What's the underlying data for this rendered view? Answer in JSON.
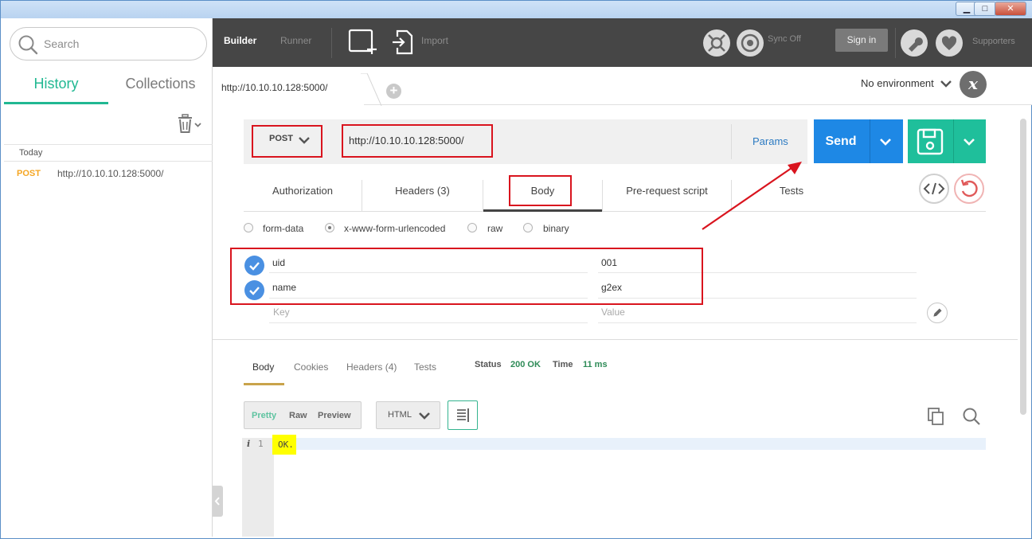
{
  "window": {
    "minimize_label": "▁",
    "maximize_label": "□",
    "close_label": "✕"
  },
  "sidebar": {
    "search_placeholder": "Search",
    "tabs": [
      {
        "label": "History",
        "active": true
      },
      {
        "label": "Collections",
        "active": false
      }
    ],
    "history_group": "Today",
    "history_items": [
      {
        "method": "POST",
        "url": "http://10.10.10.128:5000/"
      }
    ]
  },
  "toolbar": {
    "builder": "Builder",
    "runner": "Runner",
    "import": "Import",
    "sync": "Sync Off",
    "signin": "Sign in",
    "supporters": "Supporters"
  },
  "request_tabs": {
    "active_tab": "http://10.10.10.128:5000/",
    "environment": "No environment",
    "env_icon": "x"
  },
  "request": {
    "method": "POST",
    "url": "http://10.10.10.128:5000/",
    "params_label": "Params",
    "send_label": "Send"
  },
  "request_subtabs": [
    {
      "label": "Authorization"
    },
    {
      "label": "Headers (3)"
    },
    {
      "label": "Body",
      "active": true
    },
    {
      "label": "Pre-request script"
    },
    {
      "label": "Tests"
    }
  ],
  "body_types": [
    {
      "label": "form-data",
      "selected": false
    },
    {
      "label": "x-www-form-urlencoded",
      "selected": true
    },
    {
      "label": "raw",
      "selected": false
    },
    {
      "label": "binary",
      "selected": false
    }
  ],
  "body_params": [
    {
      "key": "uid",
      "value": "001",
      "enabled": true
    },
    {
      "key": "name",
      "value": "g2ex",
      "enabled": true
    }
  ],
  "new_param": {
    "key_placeholder": "Key",
    "value_placeholder": "Value"
  },
  "response": {
    "tabs": [
      {
        "label": "Body",
        "active": true
      },
      {
        "label": "Cookies"
      },
      {
        "label": "Headers (4)"
      },
      {
        "label": "Tests"
      }
    ],
    "status_label": "Status",
    "status_value": "200 OK",
    "time_label": "Time",
    "time_value": "11 ms",
    "view_modes": [
      "Pretty",
      "Raw",
      "Preview"
    ],
    "active_view": "Pretty",
    "format": "HTML",
    "line_number": "1",
    "info_marker": "i",
    "body_text": "OK."
  },
  "colors": {
    "accent_green": "#21b892",
    "send_blue": "#1e88e5",
    "save_green": "#1fbf9b",
    "post_orange": "#f5a623",
    "annotation_red": "#d9141e"
  }
}
